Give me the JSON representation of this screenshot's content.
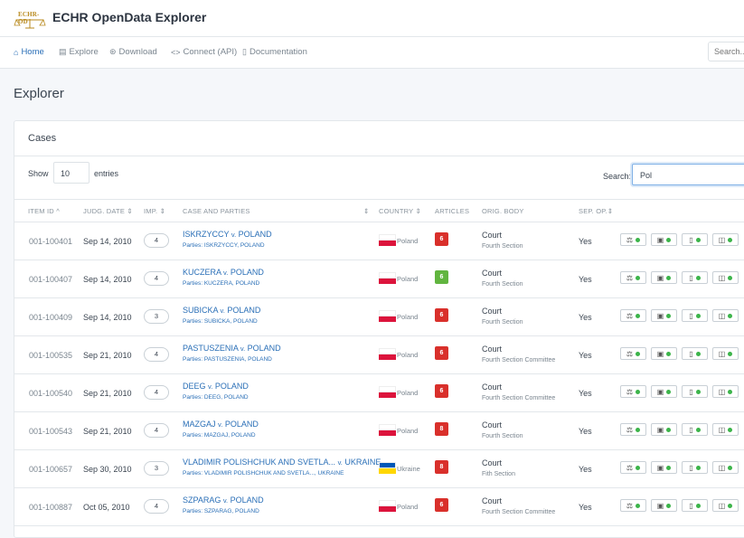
{
  "app": {
    "logo_text": "ECHR-OD",
    "title": "ECHR OpenData Explorer"
  },
  "nav": {
    "items": [
      {
        "label": "Home",
        "icon": "home-icon",
        "glyph": "⌂"
      },
      {
        "label": "Explore",
        "icon": "database-icon",
        "glyph": "▤"
      },
      {
        "label": "Download",
        "icon": "download-icon",
        "glyph": "⊛"
      },
      {
        "label": "Connect (API)",
        "icon": "code-icon",
        "glyph": "<>"
      },
      {
        "label": "Documentation",
        "icon": "document-icon",
        "glyph": "▯"
      }
    ],
    "search_placeholder": "Search..."
  },
  "page": {
    "title": "Explorer"
  },
  "cases": {
    "title": "Cases",
    "show_label": "Show",
    "entries_value": "10",
    "entries_label": "entries",
    "search_label": "Search:",
    "search_value": "Pol",
    "columns": [
      "ITEM ID",
      "JUDG. DATE",
      "IMP.",
      "CASE AND PARTIES",
      "COUNTRY",
      "ARTICLES",
      "ORIG. BODY",
      "SEP. OP."
    ],
    "sort_icon": "⇕",
    "sort_up_icon": "^",
    "rows": [
      {
        "id": "001-100401",
        "date": "Sep 14, 2010",
        "imp": "4",
        "case": "ISKRZYCCY",
        "v": "v.",
        "country_upper": "POLAND",
        "parties": "Parties: ISKRZYCCY, POLAND",
        "country": "Poland",
        "articles": "6",
        "article_color": "#d9302b",
        "body": "Court",
        "section": "Fourth Section",
        "sep": "Yes"
      },
      {
        "id": "001-100407",
        "date": "Sep 14, 2010",
        "imp": "4",
        "case": "KUCZERA",
        "v": "v.",
        "country_upper": "POLAND",
        "parties": "Parties: KUCZERA, POLAND",
        "country": "Poland",
        "articles": "6",
        "article_color": "#61b53f",
        "body": "Court",
        "section": "Fourth Section",
        "sep": "Yes"
      },
      {
        "id": "001-100409",
        "date": "Sep 14, 2010",
        "imp": "3",
        "case": "SUBICKA",
        "v": "v.",
        "country_upper": "POLAND",
        "parties": "Parties: SUBICKA, POLAND",
        "country": "Poland",
        "articles": "6",
        "article_color": "#d9302b",
        "body": "Court",
        "section": "Fourth Section",
        "sep": "Yes"
      },
      {
        "id": "001-100535",
        "date": "Sep 21, 2010",
        "imp": "4",
        "case": "PASTUSZENIA",
        "v": "v.",
        "country_upper": "POLAND",
        "parties": "Parties: PASTUSZENIA, POLAND",
        "country": "Poland",
        "articles": "6",
        "article_color": "#d9302b",
        "body": "Court",
        "section": "Fourth Section Committee",
        "sep": "Yes"
      },
      {
        "id": "001-100540",
        "date": "Sep 21, 2010",
        "imp": "4",
        "case": "DEEG",
        "v": "v.",
        "country_upper": "POLAND",
        "parties": "Parties: DEEG, POLAND",
        "country": "Poland",
        "articles": "6",
        "article_color": "#d9302b",
        "body": "Court",
        "section": "Fourth Section Committee",
        "sep": "Yes"
      },
      {
        "id": "001-100543",
        "date": "Sep 21, 2010",
        "imp": "4",
        "case": "MAZGAJ",
        "v": "v.",
        "country_upper": "POLAND",
        "parties": "Parties: MAZGAJ, POLAND",
        "country": "Poland",
        "articles": "8",
        "article_color": "#d9302b",
        "body": "Court",
        "section": "Fourth Section",
        "sep": "Yes"
      },
      {
        "id": "001-100657",
        "date": "Sep 30, 2010",
        "imp": "3",
        "case": "VLADIMIR POLISHCHUK AND SVETLA...",
        "v": "v.",
        "country_upper": "UKRAINE",
        "parties": "Parties: VLADIMIR POLISHCHUK AND SVETLA..., UKRAINE",
        "country": "Ukraine",
        "articles": "8",
        "article_color": "#d9302b",
        "body": "Court",
        "section": "Fith Section",
        "sep": "Yes"
      },
      {
        "id": "001-100887",
        "date": "Oct 05, 2010",
        "imp": "4",
        "case": "SZPARAG",
        "v": "v.",
        "country_upper": "POLAND",
        "parties": "Parties: SZPARAG, POLAND",
        "country": "Poland",
        "articles": "6",
        "article_color": "#d9302b",
        "body": "Court",
        "section": "Fourth Section Committee",
        "sep": "Yes"
      }
    ],
    "actions": [
      {
        "icon": "scales-icon",
        "glyph": "⚖"
      },
      {
        "icon": "id-card-icon",
        "glyph": "▣"
      },
      {
        "icon": "file-icon",
        "glyph": "▯"
      },
      {
        "icon": "note-icon",
        "glyph": "◫"
      }
    ]
  },
  "colors": {
    "accent": "#2a6fb7",
    "status_green": "#3cb44a",
    "poland_top": "#ffffff",
    "poland_bottom": "#dc143c",
    "ukraine_top": "#0057b7",
    "ukraine_bottom": "#ffd700"
  }
}
